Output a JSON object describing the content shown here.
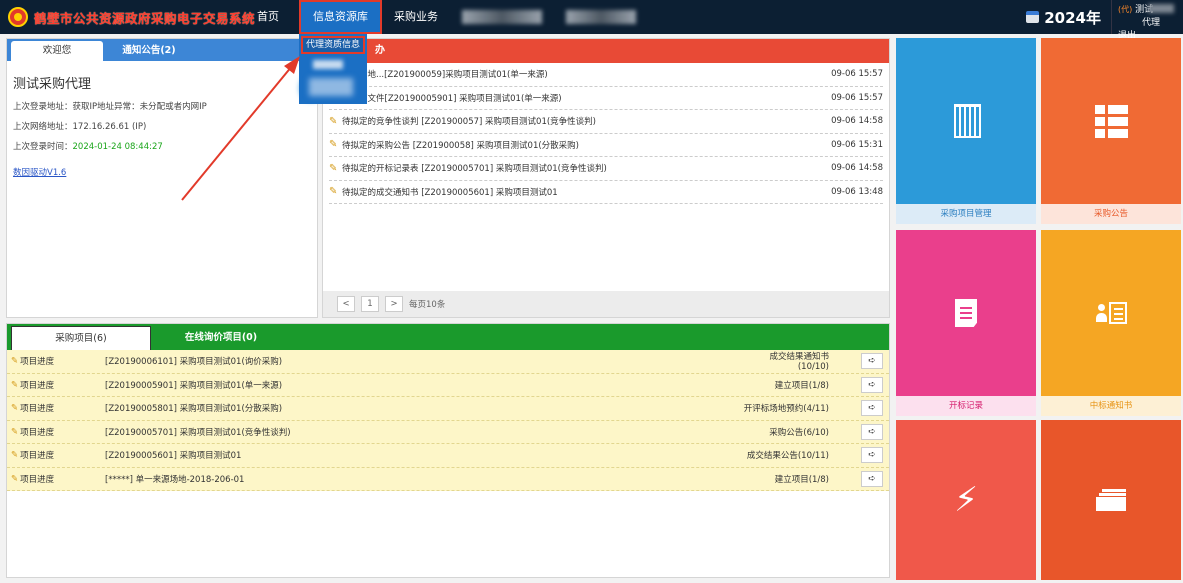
{
  "header": {
    "system_title": "鹤壁市公共资源政府采购电子交易系统",
    "nav": [
      {
        "label": "首页"
      },
      {
        "label": "信息资源库"
      },
      {
        "label": "采购业务"
      }
    ],
    "year": "2024年",
    "user_tag": "(代)",
    "user_name": "测试",
    "user_suffix": "代理",
    "logout": "退出"
  },
  "dropdown": {
    "items": [
      {
        "label": "代理资质信息"
      }
    ]
  },
  "welcome": {
    "tabs": [
      "欢迎您",
      "通知公告(2)"
    ],
    "name": "测试采购代理",
    "last_ip_label": "上次登录地址：",
    "last_ip_value": "获取IP地址异常：未分配或者内网IP",
    "last_net_label": "上次网络地址：",
    "last_net_value": "172.16.26.61 (IP)",
    "last_time_label": "上次登录时间：",
    "last_time_value": "2024-01-24 08:44:27",
    "driver_link": "数因驱动V1.6"
  },
  "todo": {
    "title": "办",
    "items": [
      {
        "text": "评标场地...[Z201900059]采购项目测试01(单一来源)",
        "date": "09-06 15:57"
      },
      {
        "text": "一来源文件[Z20190005901] 采购项目测试01(单一来源)",
        "date": "09-06 15:57"
      },
      {
        "text": "待拟定的竞争性谈判  [Z201900057] 采购项目测试01(竞争性谈判)",
        "date": "09-06 14:58"
      },
      {
        "text": "待拟定的采购公告    [Z201900058] 采购项目测试01(分散采购)",
        "date": "09-06 15:31"
      },
      {
        "text": "待拟定的开标记录表  [Z20190005701] 采购项目测试01(竞争性谈判)",
        "date": "09-06 14:58"
      },
      {
        "text": "待拟定的成交通知书  [Z20190005601] 采购项目测试01",
        "date": "09-06 13:48"
      }
    ],
    "pager": {
      "prev": "<",
      "page": "1",
      "next": ">",
      "per_page": "每页10条"
    }
  },
  "projects": {
    "tabs": [
      "采购项目(6)",
      "在线询价项目(0)"
    ],
    "rows": [
      {
        "progress": "项目进度",
        "name": "[Z20190006101] 采购项目测试01(询价采购)",
        "status": "成交结果通知书(10/10)"
      },
      {
        "progress": "项目进度",
        "name": "[Z20190005901] 采购项目测试01(单一来源)",
        "status": "建立项目(1/8)"
      },
      {
        "progress": "项目进度",
        "name": "[Z20190005801] 采购项目测试01(分散采购)",
        "status": "开评标场地预约(4/11)"
      },
      {
        "progress": "项目进度",
        "name": "[Z20190005701] 采购项目测试01(竞争性谈判)",
        "status": "采购公告(6/10)"
      },
      {
        "progress": "项目进度",
        "name": "[Z20190005601] 采购项目测试01",
        "status": "成交结果公告(10/11)"
      },
      {
        "progress": "项目进度",
        "name": "[*****] 单一来源场地-2018-206-01",
        "status": "建立项目(1/8)"
      }
    ]
  },
  "tiles": {
    "t1": {
      "label": "采购项目管理",
      "icon": "piano-icon",
      "color": "#2c9ad9"
    },
    "t2": {
      "label": "采购公告",
      "icon": "grid-list-icon",
      "color": "#f06a34"
    },
    "t3": {
      "label": "开标记录",
      "icon": "document-icon",
      "color": "#ea3f8c"
    },
    "t4": {
      "label": "中标通知书",
      "icon": "user-list-icon",
      "color": "#f5a623"
    },
    "t5": {
      "icon": "bolt-icon",
      "color": "#f0584a"
    },
    "t6": {
      "icon": "cards-icon",
      "color": "#e8562a"
    }
  }
}
